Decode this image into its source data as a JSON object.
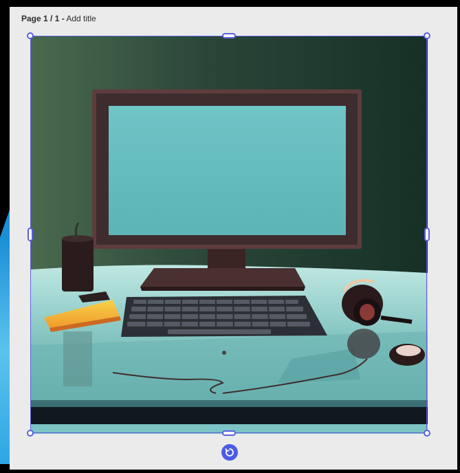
{
  "page_header": {
    "page_label": "Page 1 / 1 -",
    "add_title_label": "Add title"
  },
  "image": {
    "icon": "desk-computer-illustration",
    "description_icons": [
      "monitor",
      "keyboard",
      "candle",
      "notepad",
      "headphones",
      "mouse"
    ]
  },
  "selection": {
    "color": "#5a5ee0"
  },
  "controls": {
    "rotate_icon": "rotate-icon",
    "rotate_color": "#4b5ce4"
  }
}
